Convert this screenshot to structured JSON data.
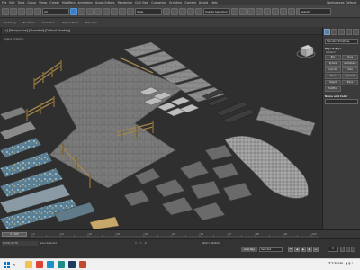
{
  "app": {
    "menus": [
      "File",
      "Edit",
      "Tools",
      "Group",
      "Views",
      "Create",
      "Modifiers",
      "Animation",
      "Graph Editors",
      "Rendering",
      "Civil View",
      "Customize",
      "Scripting",
      "Content",
      "Arnold",
      "Help"
    ],
    "workspace_label": "Workspaces: Default",
    "selection_set": "Create Selection Se",
    "search_placeholder": "Search"
  },
  "ribbon": {
    "tabs": [
      "Modeling",
      "Freeform",
      "Selection",
      "Object Paint",
      "Populate"
    ]
  },
  "viewport": {
    "label": "[+] [Perspective] [Standard] [Default Shading]",
    "scene_tab": "Scene Explorer"
  },
  "command_panel": {
    "category": "Standard Primitives",
    "section_object_type": "Object Type",
    "autogrid": "AutoGrid",
    "objects": [
      "Box",
      "Cone",
      "Sphere",
      "GeoSphere",
      "Cylinder",
      "Tube",
      "Torus",
      "Pyramid",
      "Teapot",
      "Plane",
      "TextPlus"
    ],
    "section_name_color": "Name and Color"
  },
  "timeline": {
    "slider_label": "0 / 100",
    "ticks": [
      "0",
      "10",
      "20",
      "30",
      "40",
      "50",
      "60",
      "70",
      "80",
      "90",
      "100"
    ]
  },
  "status": {
    "maxscript": "MAXScript Mi",
    "message": "None Selected",
    "x": "",
    "y": "",
    "z": "",
    "grid": "Grid = 10.0cm",
    "autokey": "Auto Key",
    "selected": "Selected",
    "frame": "0",
    "colors": {
      "accent": "#3b7ec7",
      "viewport": "#2f2f2f",
      "panel": "#3b3b3b"
    }
  },
  "taskbar": {
    "apps": [
      {
        "name": "file-explorer",
        "color": "#f2c14e"
      },
      {
        "name": "chrome",
        "color": "#db4437"
      },
      {
        "name": "edge",
        "color": "#1e90c8"
      },
      {
        "name": "3dsmax",
        "color": "#1b8c8c"
      },
      {
        "name": "photoshop",
        "color": "#1e3a5f"
      },
      {
        "name": "substance",
        "color": "#c14b2f"
      }
    ],
    "weather": "23°C  Smoke"
  }
}
